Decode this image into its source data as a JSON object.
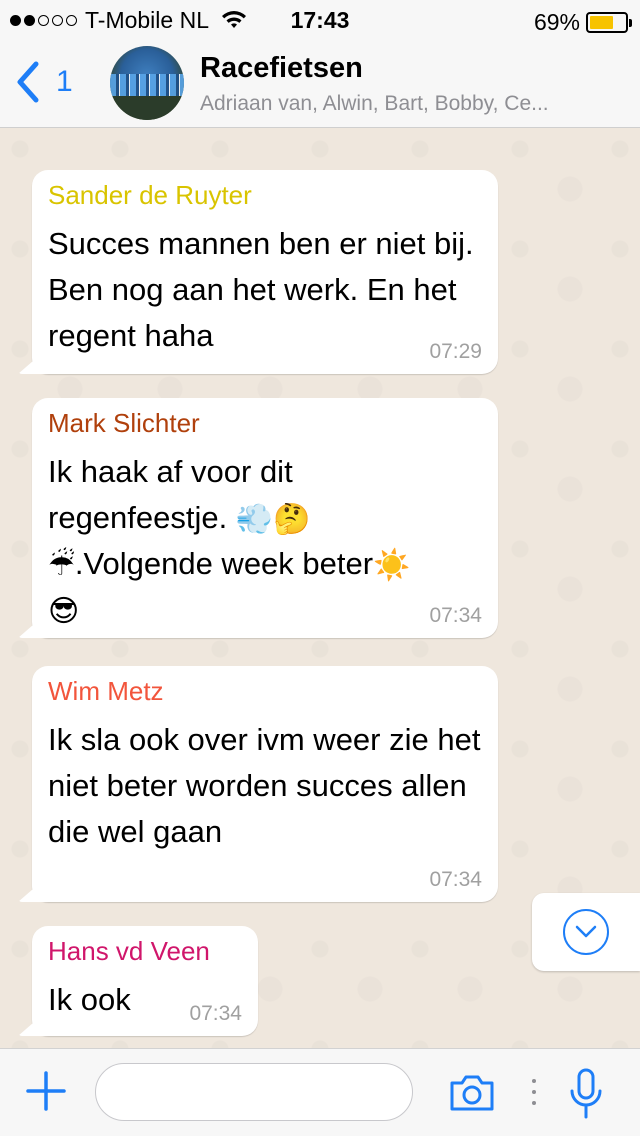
{
  "status_bar": {
    "carrier": "T-Mobile NL",
    "time": "17:43",
    "battery_percent": "69%",
    "battery_level": 0.69,
    "signal_bars_filled": 2,
    "signal_bars_total": 5
  },
  "header": {
    "back_count": "1",
    "title": "Racefietsen",
    "subtitle": "Adriaan van, Alwin, Bart, Bobby, Ce..."
  },
  "messages": [
    {
      "sender": "Sander de Ruyter",
      "sender_color": "#d9c400",
      "text": "Succes mannen ben er niet bij. Ben nog aan het werk. En het regent haha",
      "time": "07:29"
    },
    {
      "sender": "Mark Slichter",
      "sender_color": "#b0400c",
      "text_line1": "Ik haak af voor dit",
      "text_line2": "regenfeestje.",
      "emoji_a": "💨",
      "emoji_b": "🤔",
      "emoji_c": "☔",
      "text_line3": ".Volgende week beter",
      "emoji_d": "☀️",
      "emoji_e": "😎",
      "time": "07:34"
    },
    {
      "sender": "Wim Metz",
      "sender_color": "#f2553c",
      "text": "Ik sla ook over ivm weer zie het niet beter worden succes allen die wel gaan",
      "time": "07:34"
    },
    {
      "sender": "Hans vd Veen",
      "sender_color": "#d0166b",
      "text": "Ik ook",
      "time": "07:34"
    }
  ],
  "input": {
    "placeholder": "",
    "value": ""
  },
  "colors": {
    "accent": "#1e7ef7",
    "chat_background": "#efe7dd",
    "bubble": "#ffffff",
    "battery_fill": "#f7c300"
  },
  "icons": {
    "back": "chevron-left-icon",
    "scroll_down": "chevron-down-circle-icon",
    "attach": "plus-icon",
    "camera": "camera-icon",
    "mic": "microphone-icon"
  }
}
